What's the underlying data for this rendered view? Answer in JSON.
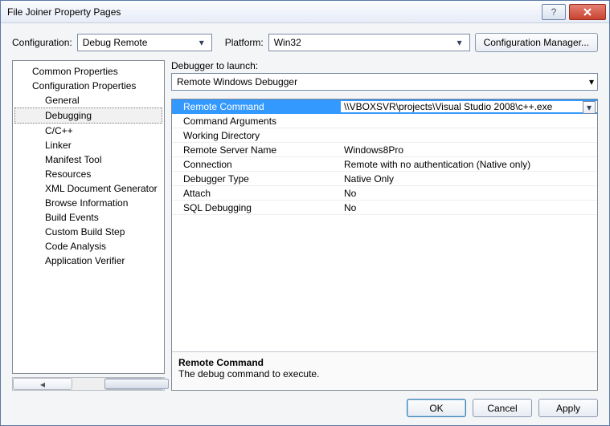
{
  "window": {
    "title": "File Joiner Property Pages"
  },
  "toprow": {
    "configLabel": "Configuration:",
    "configValue": "Debug Remote",
    "platformLabel": "Platform:",
    "platformValue": "Win32",
    "managerButton": "Configuration Manager..."
  },
  "tree": {
    "top1": "Common Properties",
    "top2": "Configuration Properties",
    "sub": {
      "general": "General",
      "debugging": "Debugging",
      "cpp": "C/C++",
      "linker": "Linker",
      "manifest": "Manifest Tool",
      "resources": "Resources",
      "xml": "XML Document Generator",
      "browse": "Browse Information",
      "build": "Build Events",
      "custom": "Custom Build Step",
      "code": "Code Analysis",
      "appver": "Application Verifier"
    }
  },
  "launcher": {
    "label": "Debugger to launch:",
    "value": "Remote Windows Debugger"
  },
  "grid": {
    "remoteCommand": {
      "k": "Remote Command",
      "v": "\\\\VBOXSVR\\projects\\Visual Studio 2008\\c++.exe"
    },
    "commandArgs": {
      "k": "Command Arguments",
      "v": ""
    },
    "workingDir": {
      "k": "Working Directory",
      "v": ""
    },
    "remoteServer": {
      "k": "Remote Server Name",
      "v": "Windows8Pro"
    },
    "connection": {
      "k": "Connection",
      "v": "Remote with no authentication (Native only)"
    },
    "debuggerType": {
      "k": "Debugger Type",
      "v": "Native Only"
    },
    "attach": {
      "k": "Attach",
      "v": "No"
    },
    "sql": {
      "k": "SQL Debugging",
      "v": "No"
    }
  },
  "description": {
    "title": "Remote Command",
    "body": "The debug command to execute."
  },
  "buttons": {
    "ok": "OK",
    "cancel": "Cancel",
    "apply": "Apply"
  }
}
